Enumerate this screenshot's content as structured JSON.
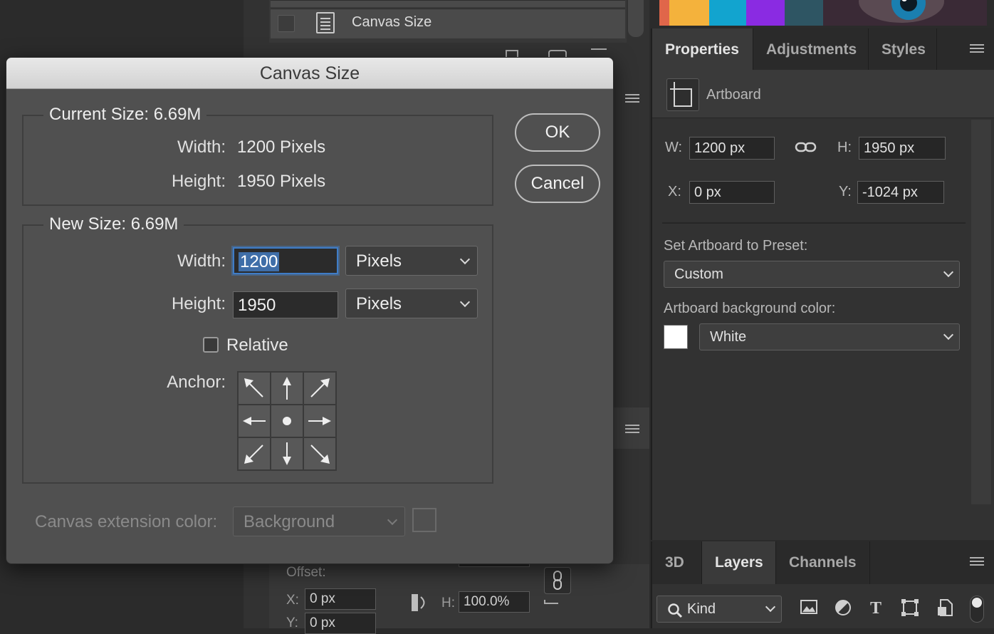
{
  "history": {
    "item_label": "Canvas Size"
  },
  "bottom_strip": {
    "offset_label": "Offset:",
    "x_label": "X:",
    "x_value": "0 px",
    "y_label": "Y:",
    "y_value": "0 px",
    "h_label": "H:",
    "h_value": "100.0%"
  },
  "properties": {
    "tabs": [
      "Properties",
      "Adjustments",
      "Styles"
    ],
    "header_label": "Artboard",
    "w_label": "W:",
    "w_value": "1200 px",
    "h_label": "H:",
    "h_value": "1950 px",
    "x_label": "X:",
    "x_value": "0 px",
    "y_label": "Y:",
    "y_value": "-1024 px",
    "preset_label": "Set Artboard to Preset:",
    "preset_value": "Custom",
    "bg_color_label": "Artboard background color:",
    "bg_color_value": "White",
    "bg_swatch_color": "#ffffff"
  },
  "layers": {
    "tabs": [
      "3D",
      "Layers",
      "Channels"
    ],
    "kind_label": "Kind"
  },
  "dialog": {
    "title": "Canvas Size",
    "current_size_label": "Current Size: 6.69M",
    "current_width_label": "Width:",
    "current_width_value": "1200 Pixels",
    "current_height_label": "Height:",
    "current_height_value": "1950 Pixels",
    "new_size_label": "New Size: 6.69M",
    "new_width_label": "Width:",
    "new_width_value": "1200",
    "new_height_label": "Height:",
    "new_height_value": "1950",
    "width_unit": "Pixels",
    "height_unit": "Pixels",
    "relative_label": "Relative",
    "anchor_label": "Anchor:",
    "ok_label": "OK",
    "cancel_label": "Cancel",
    "extension_label": "Canvas extension color:",
    "extension_value": "Background"
  }
}
